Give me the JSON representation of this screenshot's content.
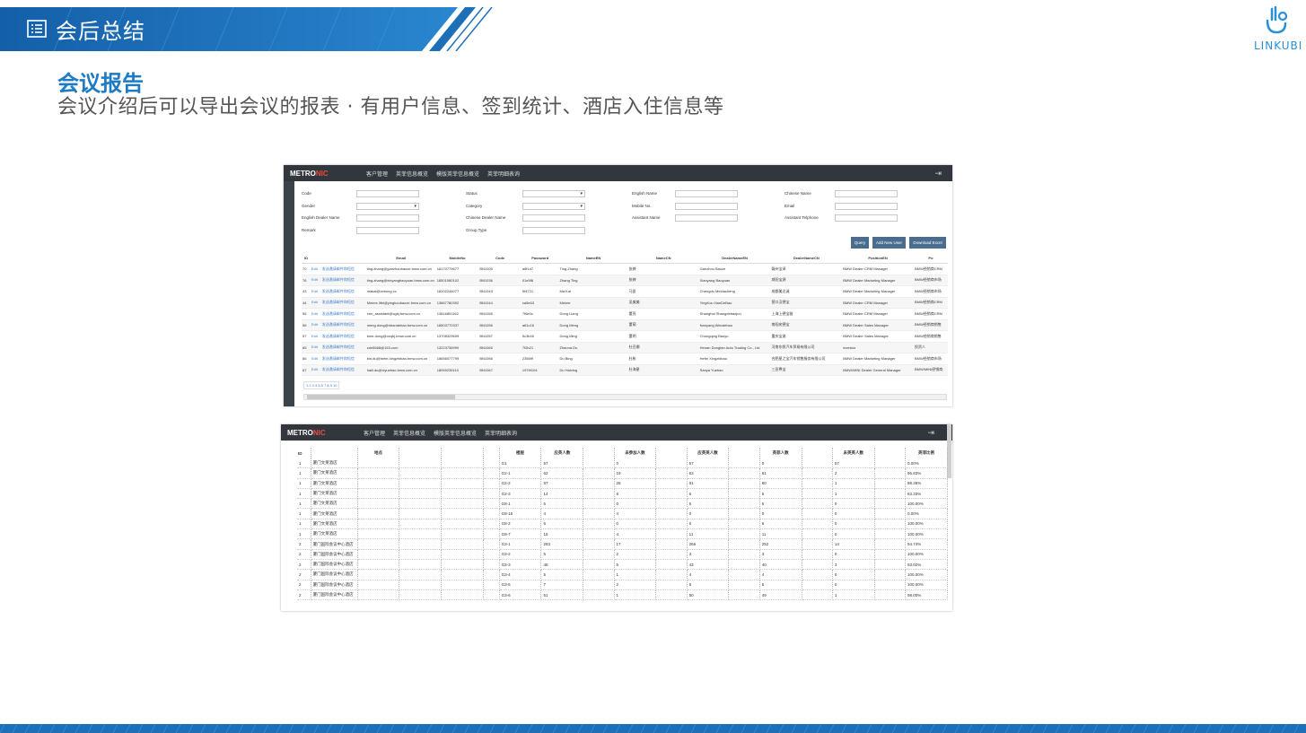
{
  "header": {
    "title": "会后总结",
    "icon": "document-list-icon",
    "banner_color": "#1d6fb8",
    "logo_text": "LINKUBI"
  },
  "section": {
    "title": "会议报告",
    "subtitle": "会议介绍后可以导出会议的报表 · 有用户信息、签到统计、酒店入住信息等"
  },
  "shot1": {
    "brand": "METRO",
    "brand_accent": "NIC",
    "nav": [
      "客户管理",
      "英菲信息概览",
      "模版英菲信息概览",
      "英菲明细表询"
    ],
    "form": {
      "code": "Code",
      "status": "Status",
      "english_name": "English Name",
      "chinese_name": "Chinese Name",
      "gender": "Gender",
      "category": "Category",
      "mobile_no": "Mobile No.",
      "email": "Email",
      "english_dealer_name": "English Dealer Name",
      "chinese_dealer_name": "Chinese Dealer Name",
      "assistant_name": "Assistant Name",
      "assistant_telphone": "Assistant Telphone",
      "remark": "Remark",
      "group_type": "Group Type"
    },
    "buttons": {
      "query": "Query",
      "add": "Add New User",
      "download": "Download Excel"
    },
    "columns": [
      "ID",
      "",
      "Email",
      "MobileNo",
      "Code",
      "Password",
      "NameEN",
      "NameCN",
      "DealerNameEN",
      "DealerNameCN",
      "PositionEN",
      "Po"
    ],
    "rows": [
      [
        "70",
        "Edit",
        "发送邀请邮件和短信",
        "ting.zhang@ganzhoubaoze.bmw.com.cn",
        "18170779677",
        "BN1005",
        "a8f1d7",
        "Ting Zhang",
        "张婷",
        "Ganzhou Baoze",
        "赣州宝泽",
        "BMW Dealer CRM Manager",
        "BMW经销商CRM"
      ],
      [
        "76",
        "Edit",
        "发送邀请邮件和短信",
        "ting.zhang@xinyangbaoyuan.bmw.com.cn",
        "18501080102",
        "BN1036",
        "01e5f8",
        "Zhang Ting",
        "张婷",
        "Xianyang Baoyuan",
        "咸阳宝源",
        "BMW Dealer Marketing Manager",
        "BMW经销商市场"
      ],
      [
        "43",
        "Edit",
        "发送邀请邮件和短信",
        "makai@zebong.cc",
        "18202246077",
        "BN1043",
        "5f4721",
        "Ma Kai",
        "马凯",
        "Chengdu Meidacheng",
        "成都美达诚",
        "BMW Dealer Marketing Manager",
        "BMW经销商市场"
      ],
      [
        "44",
        "Edit",
        "发送邀请邮件和短信",
        "Meime.lifei@yingkoubaoze.bmw.com.cn",
        "13667780392",
        "BN1044",
        "ca5e63",
        "Meime",
        "吴美美",
        "YingKou HanDeBao",
        "营口汉德宝",
        "BMW Dealer CRM Manager",
        "BMW经销商CRM"
      ],
      [
        "55",
        "Edit",
        "发送邀请邮件和短信",
        "crm_assistant@sgbj.bmw.com.cn",
        "13816891162",
        "BN1055",
        "7f6e0c",
        "Dong Liang",
        "董亮",
        "Shanghai Shangdebaojun",
        "上海上德宝骏",
        "BMW Dealer CRM Manager",
        "BMW经销商CRM"
      ],
      [
        "56",
        "Edit",
        "发送邀请邮件和短信",
        "meng.dong@nbandebao.bmw.com.cn",
        "18503770337",
        "BN1056",
        "a61c16",
        "Dong Meng",
        "董萌",
        "Nanyang Wandebao",
        "南阳宛德宝",
        "BMW Dealer Sales Manager",
        "BMW经销商销售"
      ],
      [
        "57",
        "Edit",
        "发送邀请邮件和短信",
        "bme.dong@ceqbj.bmw.com.cn",
        "13708329699",
        "BN1057",
        "5c3b40",
        "Dong Ming",
        "董明",
        "Chongqing Baoyu",
        "重庆宝渝",
        "BMW Dealer Sales Manager",
        "BMW经销商销售"
      ],
      [
        "65",
        "Edit",
        "发送邀请邮件和短信",
        "zdn5668@163.com",
        "13223736999",
        "BN1065",
        "7f2b21",
        "Zhaona Du",
        "杜召娜",
        "Henan Dongfan Auto Trading Co., Ltd",
        "河南东帆汽车贸易有限公司",
        "investor",
        "投资人"
      ],
      [
        "66",
        "Edit",
        "发送邀请邮件和短信",
        "bin.du@hefei-xingzhibao.bmw.com.cn",
        "18656077799",
        "BN1066",
        "2356f9",
        "Du Bing",
        "杜彬",
        "Hefei Xingzhibao",
        "合肥星之宝汽车销售服务有限公司",
        "BMW Dealer Marketing Manager",
        "BMW经销商市场"
      ],
      [
        "67",
        "Edit",
        "发送邀请邮件和短信",
        "haili.du@xiyuebao.bmw.com.cn",
        "18059235110",
        "BN1067",
        "1976f104",
        "Du Haixing",
        "杜海星",
        "Sanya Yuebao",
        "三亚粤宝",
        "BMW/MINI Dealer General Manager",
        "BMW/MINI经销商"
      ]
    ],
    "pager": "1 2 3 4 5 6 7 8 9 10"
  },
  "shot2": {
    "brand": "METRO",
    "brand_accent": "NIC",
    "nav": [
      "客户管理",
      "英菲信息概览",
      "模版英菲信息概览",
      "英菲明细表询"
    ],
    "columns": [
      "ID",
      "",
      "地点",
      "",
      "",
      "",
      "楼层",
      "应英人数",
      "",
      "未参加人数",
      "",
      "应英英人数",
      "",
      "英菲人数",
      "",
      "未英英人数",
      "",
      "英菲比例"
    ],
    "rows": [
      [
        "1",
        "厦门文莱酒店",
        "G1",
        "57",
        "0",
        "57",
        "0",
        "57",
        "0.00%"
      ],
      [
        "1",
        "厦门文莱酒店",
        "G2-1",
        "62",
        "19",
        "63",
        "61",
        "2",
        "96.83%"
      ],
      [
        "1",
        "厦门文莱酒店",
        "G2-2",
        "87",
        "26",
        "61",
        "60",
        "1",
        "98.36%"
      ],
      [
        "1",
        "厦门文莱酒店",
        "G2-3",
        "14",
        "8",
        "6",
        "5",
        "1",
        "83.33%"
      ],
      [
        "1",
        "厦门文莱酒店",
        "G8-1",
        "5",
        "0",
        "5",
        "5",
        "0",
        "100.00%"
      ],
      [
        "1",
        "厦门文莱酒店",
        "G8-15",
        "4",
        "4",
        "0",
        "0",
        "0",
        "0.00%"
      ],
      [
        "1",
        "厦门文莱酒店",
        "G8-2",
        "6",
        "0",
        "6",
        "6",
        "0",
        "100.00%"
      ],
      [
        "1",
        "厦门文莱酒店",
        "G8-7",
        "15",
        "4",
        "11",
        "11",
        "0",
        "100.00%"
      ],
      [
        "2",
        "厦门国际会议中心酒店",
        "G3-1",
        "283",
        "17",
        "266",
        "252",
        "14",
        "94.74%"
      ],
      [
        "2",
        "厦门国际会议中心酒店",
        "G3-2",
        "5",
        "2",
        "3",
        "3",
        "0",
        "100.00%"
      ],
      [
        "2",
        "厦门国际会议中心酒店",
        "G3-3",
        "48",
        "5",
        "43",
        "40",
        "3",
        "93.02%"
      ],
      [
        "2",
        "厦门国际会议中心酒店",
        "G3-4",
        "5",
        "1",
        "4",
        "4",
        "0",
        "100.00%"
      ],
      [
        "2",
        "厦门国际会议中心酒店",
        "G3-5",
        "7",
        "2",
        "5",
        "5",
        "0",
        "100.00%"
      ],
      [
        "2",
        "厦门国际会议中心酒店",
        "G3-6",
        "51",
        "1",
        "50",
        "49",
        "1",
        "98.00%"
      ]
    ]
  }
}
